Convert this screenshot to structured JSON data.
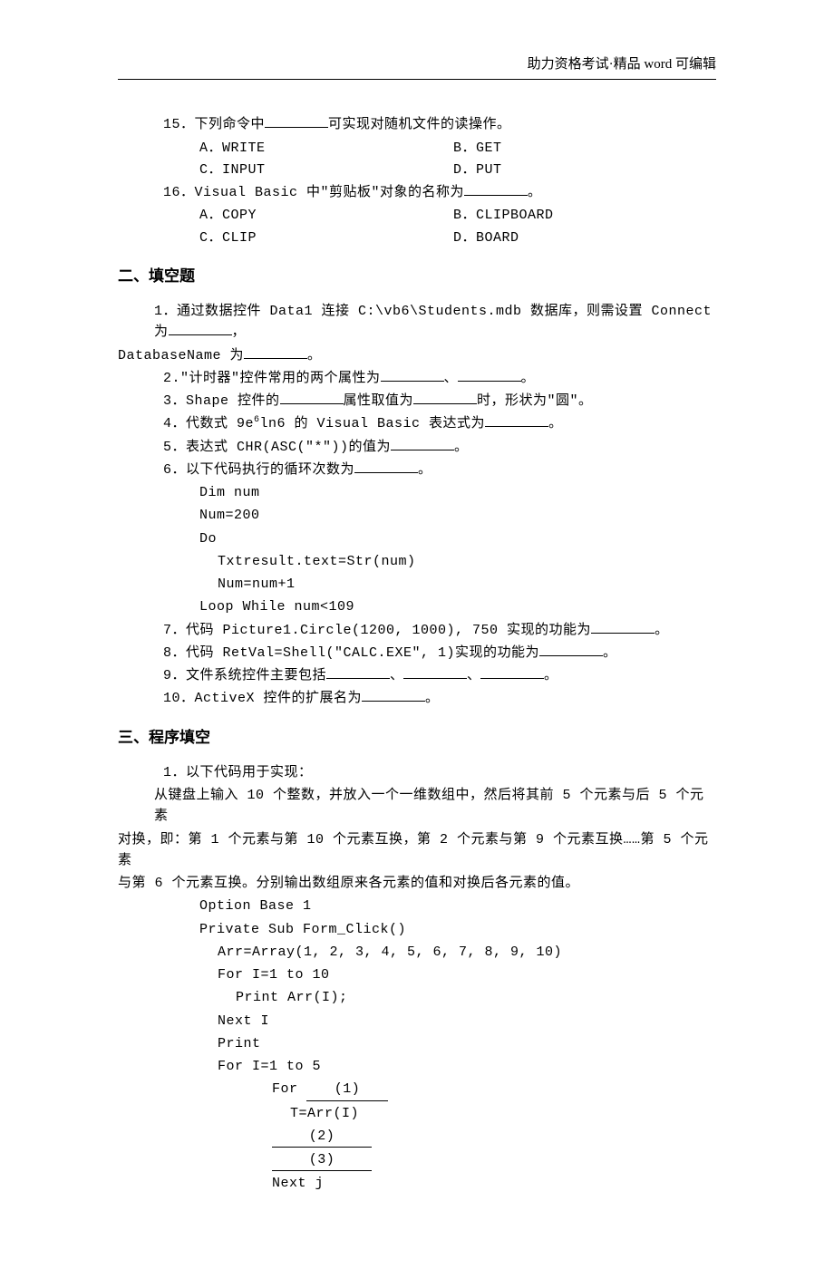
{
  "header": "助力资格考试·精品 word 可编辑",
  "mc": {
    "q15": {
      "text": "15．下列命令中",
      "tail": "可实现对随机文件的读操作。",
      "a": "A．WRITE",
      "b": "B．GET",
      "c": "C．INPUT",
      "d": "D．PUT"
    },
    "q16": {
      "text": "16．Visual Basic 中\"剪贴板\"对象的名称为",
      "tail": "。",
      "a": "A．COPY",
      "b": "B．CLIPBOARD",
      "c": "C．CLIP",
      "d": "D．BOARD"
    }
  },
  "sec2": {
    "title": "二、填空题",
    "q1a": "1．通过数据控件 Data1 连接 C:\\vb6\\Students.mdb 数据库，则需设置 Connect 为",
    "q1b": "，",
    "q1c": "DatabaseName 为",
    "q1d": "。",
    "q2a": "2.\"计时器\"控件常用的两个属性为",
    "q2sep": "、",
    "q2end": "。",
    "q3a": "3．Shape 控件的",
    "q3b": "属性取值为",
    "q3c": "时，形状为\"圆\"。",
    "q4a": "4．代数式 9e",
    "q4sup": "6",
    "q4b": "ln6 的 Visual Basic 表达式为",
    "q4end": "。",
    "q5a": "5．表达式 CHR(ASC(\"*\"))的值为",
    "q5end": "。",
    "q6a": "6．以下代码执行的循环次数为",
    "q6end": "。",
    "code": {
      "l1": "Dim num",
      "l2": "Num=200",
      "l3": "Do",
      "l4": "Txtresult.text=Str(num)",
      "l5": "Num=num+1",
      "l6": "Loop While num<109"
    },
    "q7a": "7．代码 Picture1.Circle(1200, 1000), 750 实现的功能为",
    "q7end": "。",
    "q8a": "8．代码 RetVal=Shell(\"CALC.EXE\", 1)实现的功能为",
    "q8end": "。",
    "q9a": "9．文件系统控件主要包括",
    "q9sep": "、",
    "q9end": "。",
    "q10a": "10．ActiveX 控件的扩展名为",
    "q10end": "。"
  },
  "sec3": {
    "title": "三、程序填空",
    "intro1": "1．以下代码用于实现：",
    "desc1": "从键盘上输入 10 个整数，并放入一个一维数组中，然后将其前 5 个元素与后 5 个元素",
    "desc2": "对换，即：第 1 个元素与第 10 个元素互换，第 2 个元素与第 9 个元素互换……第 5 个元素",
    "desc3": "与第 6 个元素互换。分别输出数组原来各元素的值和对换后各元素的值。",
    "code": {
      "l1": "Option Base 1",
      "l2": "Private Sub Form_Click()",
      "l3": "Arr=Array(1, 2, 3, 4, 5, 6, 7, 8, 9, 10)",
      "l4": "For I=1 to 10",
      "l5": "Print Arr(I);",
      "l6": "Next I",
      "l7": "Print",
      "l8": "For I=1 to 5",
      "l9": "For ",
      "b1": "(1)",
      "l10": "T=Arr(I)",
      "b2": "(2)",
      "b3": "(3)",
      "l11": "Next j"
    }
  }
}
